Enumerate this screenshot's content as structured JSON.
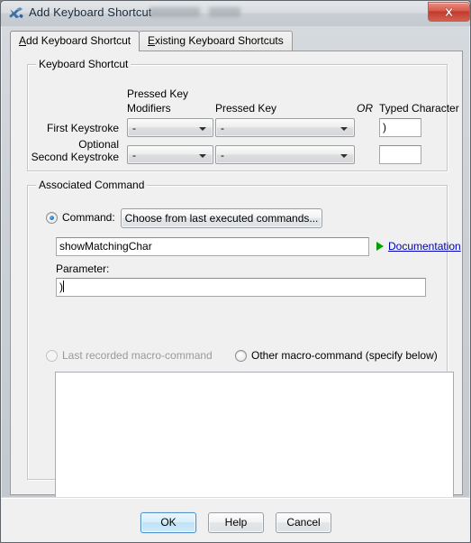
{
  "window": {
    "title": "Add Keyboard Shortcut",
    "icon": "app-x-icon",
    "close_glyph": "✕"
  },
  "tabs": [
    {
      "label": "Add Keyboard Shortcut",
      "mnemonic": "A",
      "active": true
    },
    {
      "label": "Existing Keyboard Shortcuts",
      "mnemonic": "E",
      "active": false
    }
  ],
  "keyboard_shortcut": {
    "group_title": "Keyboard Shortcut",
    "headers": {
      "pressed_key_modifiers_line1": "Pressed Key",
      "pressed_key_modifiers_line2": "Modifiers",
      "pressed_key": "Pressed Key",
      "or": "OR",
      "typed_character": "Typed Character"
    },
    "rows": [
      {
        "label_line1": "First Keystroke",
        "label_line2": "",
        "modifiers_value": "-",
        "key_value": "-",
        "typed_character": ")"
      },
      {
        "label_line1": "Optional",
        "label_line2": "Second Keystroke",
        "modifiers_value": "-",
        "key_value": "-",
        "typed_character": ""
      }
    ]
  },
  "associated_command": {
    "group_title": "Associated Command",
    "command_radio_label": "Command:",
    "command_radio_checked": true,
    "choose_button_label": "Choose from last executed commands...",
    "command_value": "showMatchingChar",
    "documentation_link": "Documentation",
    "parameter_label": "Parameter:",
    "parameter_value": ")",
    "last_recorded_label": "Last recorded macro-command",
    "last_recorded_disabled": true,
    "other_macro_label": "Other macro-command (specify below)",
    "other_macro_checked": false,
    "macro_text": ""
  },
  "buttons": {
    "ok": "OK",
    "help": "Help",
    "cancel": "Cancel"
  },
  "colors": {
    "link": "#0000c0",
    "doc_triangle": "#00a000",
    "radio_dot": "#1b74c4",
    "close_button": "#c03a2c",
    "default_button_border": "#4e8fc7",
    "dialog_bg": "#f0f0f0"
  }
}
